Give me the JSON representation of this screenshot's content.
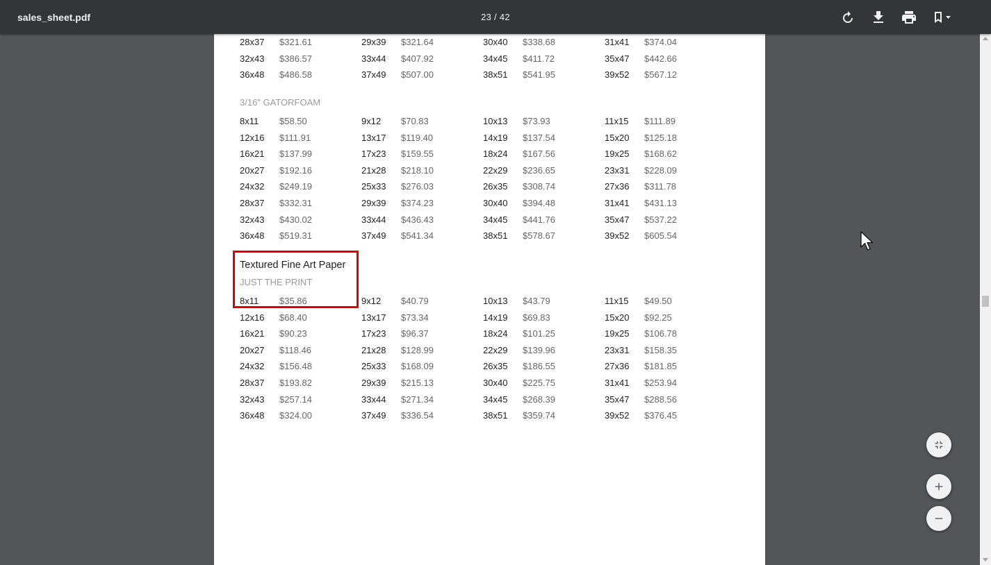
{
  "toolbar": {
    "doc_title": "sales_sheet.pdf",
    "page_indicator": "23 / 42",
    "rotate_icon": "rotate-icon",
    "download_icon": "download-icon",
    "print_icon": "print-icon",
    "bookmark_icon": "bookmark-icon"
  },
  "sheet": {
    "top_rows": [
      [
        [
          "28x37",
          "$321.61"
        ],
        [
          "29x39",
          "$321.64"
        ],
        [
          "30x40",
          "$338.68"
        ],
        [
          "31x41",
          "$374.04"
        ]
      ],
      [
        [
          "32x43",
          "$386.57"
        ],
        [
          "33x44",
          "$407.92"
        ],
        [
          "34x45",
          "$411.72"
        ],
        [
          "35x47",
          "$442.66"
        ]
      ],
      [
        [
          "36x48",
          "$486.58"
        ],
        [
          "37x49",
          "$507.00"
        ],
        [
          "38x51",
          "$541.95"
        ],
        [
          "39x52",
          "$567.12"
        ]
      ]
    ],
    "gatorfoam": {
      "label": "3/16\" GATORFOAM",
      "rows": [
        [
          [
            "8x11",
            "$58.50"
          ],
          [
            "9x12",
            "$70.83"
          ],
          [
            "10x13",
            "$73.93"
          ],
          [
            "11x15",
            "$111.89"
          ]
        ],
        [
          [
            "12x16",
            "$111.91"
          ],
          [
            "13x17",
            "$119.40"
          ],
          [
            "14x19",
            "$137.54"
          ],
          [
            "15x20",
            "$125.18"
          ]
        ],
        [
          [
            "16x21",
            "$137.99"
          ],
          [
            "17x23",
            "$159.55"
          ],
          [
            "18x24",
            "$167.56"
          ],
          [
            "19x25",
            "$168.62"
          ]
        ],
        [
          [
            "20x27",
            "$192.16"
          ],
          [
            "21x28",
            "$218.10"
          ],
          [
            "22x29",
            "$236.65"
          ],
          [
            "23x31",
            "$228.09"
          ]
        ],
        [
          [
            "24x32",
            "$249.19"
          ],
          [
            "25x33",
            "$276.03"
          ],
          [
            "26x35",
            "$308.74"
          ],
          [
            "27x36",
            "$311.78"
          ]
        ],
        [
          [
            "28x37",
            "$332.31"
          ],
          [
            "29x39",
            "$374.23"
          ],
          [
            "30x40",
            "$394.48"
          ],
          [
            "31x41",
            "$431.13"
          ]
        ],
        [
          [
            "32x43",
            "$430.02"
          ],
          [
            "33x44",
            "$436.43"
          ],
          [
            "34x45",
            "$441.76"
          ],
          [
            "35x47",
            "$537.22"
          ]
        ],
        [
          [
            "36x48",
            "$519.31"
          ],
          [
            "37x49",
            "$541.34"
          ],
          [
            "38x51",
            "$578.67"
          ],
          [
            "39x52",
            "$605.54"
          ]
        ]
      ]
    },
    "textured": {
      "heading": "Textured Fine Art Paper",
      "label": "JUST THE PRINT",
      "rows": [
        [
          [
            "8x11",
            "$35.86"
          ],
          [
            "9x12",
            "$40.79"
          ],
          [
            "10x13",
            "$43.79"
          ],
          [
            "11x15",
            "$49.50"
          ]
        ],
        [
          [
            "12x16",
            "$68.40"
          ],
          [
            "13x17",
            "$73.34"
          ],
          [
            "14x19",
            "$69.83"
          ],
          [
            "15x20",
            "$92.25"
          ]
        ],
        [
          [
            "16x21",
            "$90.23"
          ],
          [
            "17x23",
            "$96.37"
          ],
          [
            "18x24",
            "$101.25"
          ],
          [
            "19x25",
            "$106.78"
          ]
        ],
        [
          [
            "20x27",
            "$118.46"
          ],
          [
            "21x28",
            "$128.99"
          ],
          [
            "22x29",
            "$139.96"
          ],
          [
            "23x31",
            "$158.35"
          ]
        ],
        [
          [
            "24x32",
            "$156.48"
          ],
          [
            "25x33",
            "$168.09"
          ],
          [
            "26x35",
            "$186.55"
          ],
          [
            "27x36",
            "$181.85"
          ]
        ],
        [
          [
            "28x37",
            "$193.82"
          ],
          [
            "29x39",
            "$215.13"
          ],
          [
            "30x40",
            "$225.75"
          ],
          [
            "31x41",
            "$253.94"
          ]
        ],
        [
          [
            "32x43",
            "$257.14"
          ],
          [
            "33x44",
            "$271.34"
          ],
          [
            "34x45",
            "$268.39"
          ],
          [
            "35x47",
            "$288.56"
          ]
        ],
        [
          [
            "36x48",
            "$324.00"
          ],
          [
            "37x49",
            "$336.54"
          ],
          [
            "38x51",
            "$359.74"
          ],
          [
            "39x52",
            "$376.45"
          ]
        ]
      ]
    }
  },
  "controls": {
    "fit_icon": "fit-to-page-icon",
    "zoom_in_icon": "plus-icon",
    "zoom_out_icon": "minus-icon"
  },
  "colors": {
    "toolbar_bg": "#323639",
    "viewer_bg": "#525659",
    "highlight": "#e00000"
  }
}
